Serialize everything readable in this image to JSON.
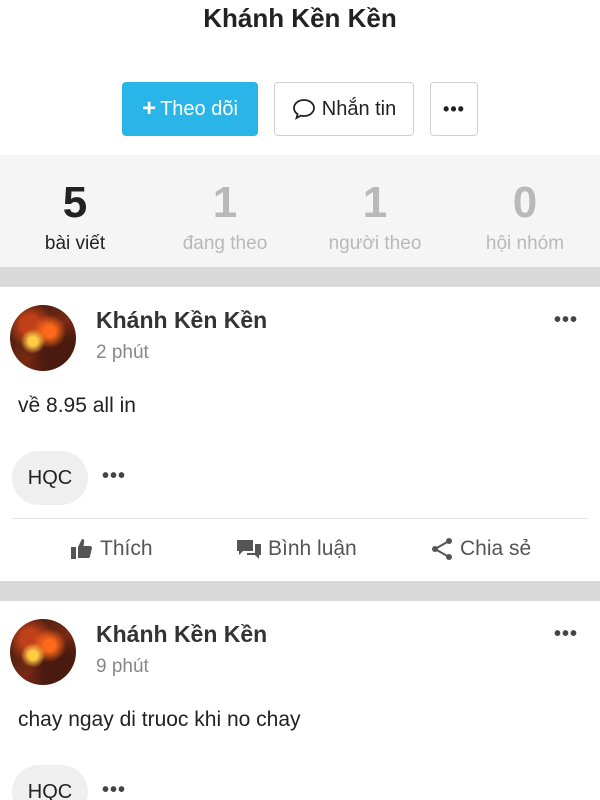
{
  "profile": {
    "name": "Khánh Kền Kền"
  },
  "actions": {
    "follow_label": "Theo dõi",
    "follow_plus": "+",
    "message_label": "Nhắn tin",
    "more_label": "•••"
  },
  "stats": [
    {
      "value": "5",
      "label": "bài viết"
    },
    {
      "value": "1",
      "label": "đang theo"
    },
    {
      "value": "1",
      "label": "người theo"
    },
    {
      "value": "0",
      "label": "hội nhóm"
    }
  ],
  "posts": [
    {
      "author": "Khánh Kền Kền",
      "time": "2 phút",
      "content": "về 8.95 all in",
      "tag": "HQC",
      "more": "•••"
    },
    {
      "author": "Khánh Kền Kền",
      "time": "9 phút",
      "content": "chay ngay di truoc khi no chay",
      "tag": "HQC",
      "more": "•••"
    }
  ],
  "post_actions": {
    "like": "Thích",
    "comment": "Bình luận",
    "share": "Chia sẻ"
  },
  "colors": {
    "accent": "#29b5e8",
    "muted": "#b9b9b9",
    "gap": "#d9d9d9",
    "stats_bg": "#f5f5f5"
  },
  "icons": {
    "message": "speech-bubble-icon",
    "like": "thumbs-up-icon",
    "comment": "comment-icon",
    "share": "share-icon"
  }
}
